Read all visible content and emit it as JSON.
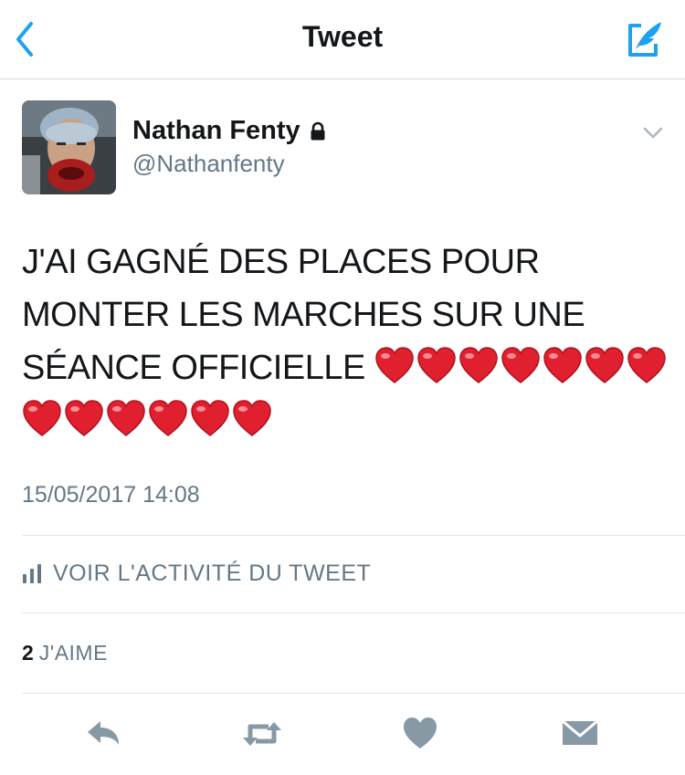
{
  "header": {
    "title": "Tweet",
    "back_icon": "chevron-left-icon",
    "compose_icon": "compose-tweet-icon",
    "accent_color": "#1da1f2"
  },
  "author": {
    "name": "Nathan Fenty",
    "handle": "@Nathanfenty",
    "protected": true
  },
  "tweet": {
    "line1": "J'AI GAGNÉ DES PLACES POUR",
    "line2": "MONTER LES MARCHES SUR UNE",
    "line3": "SÉANCE OFFICIELLE",
    "hearts_line3": 7,
    "hearts_line4": 6,
    "emoji": "red-heart",
    "timestamp": "15/05/2017 14:08"
  },
  "activity": {
    "label": "VOIR L'ACTIVITÉ DU TWEET",
    "icon": "bar-chart-icon"
  },
  "likes": {
    "count": "2",
    "label": "J'AIME"
  },
  "actions": [
    {
      "name": "reply",
      "icon": "reply-icon"
    },
    {
      "name": "retweet",
      "icon": "retweet-icon"
    },
    {
      "name": "like",
      "icon": "heart-icon"
    },
    {
      "name": "direct-message",
      "icon": "envelope-icon"
    }
  ]
}
